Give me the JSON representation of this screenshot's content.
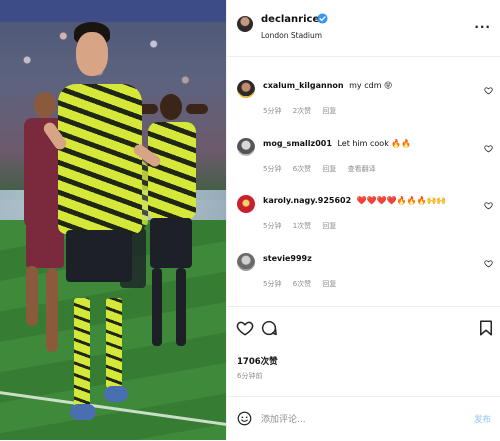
{
  "post": {
    "username": "declanrice",
    "location": "London Stadium",
    "more_label": "···"
  },
  "comments": [
    {
      "user": "cxalum_kilgannon",
      "text": "my cdm 😝",
      "time": "5分钟",
      "likes": "2次赞",
      "reply": "回复",
      "extra": ""
    },
    {
      "user": "mog_smallz001",
      "text": "Let him cook 🔥🔥",
      "time": "5分钟",
      "likes": "6次赞",
      "reply": "回复",
      "extra": "查看翻译"
    },
    {
      "user": "karoly.nagy.925602",
      "text": "❤️❤️❤️❤️🔥🔥🔥🙌🙌",
      "time": "5分钟",
      "likes": "1次赞",
      "reply": "回复",
      "extra": ""
    },
    {
      "user": "stevie999z",
      "text": "",
      "time": "5分钟",
      "likes": "6次赞",
      "reply": "回复",
      "extra": ""
    }
  ],
  "stats": {
    "likes": "1706次赞",
    "posted": "6分钟前"
  },
  "composer": {
    "placeholder": "添加评论...",
    "post_label": "发布"
  },
  "icons": {
    "verified": "verified-badge-icon",
    "like": "heart-icon",
    "comment": "comment-icon",
    "save": "bookmark-icon",
    "emoji": "emoji-icon",
    "more": "more-horizontal-icon"
  },
  "colors": {
    "verified_blue": "#3897f0",
    "muted_text": "#8e8e8e",
    "post_button": "#b3d4f5",
    "kit_yellow": "#d5e83a"
  }
}
